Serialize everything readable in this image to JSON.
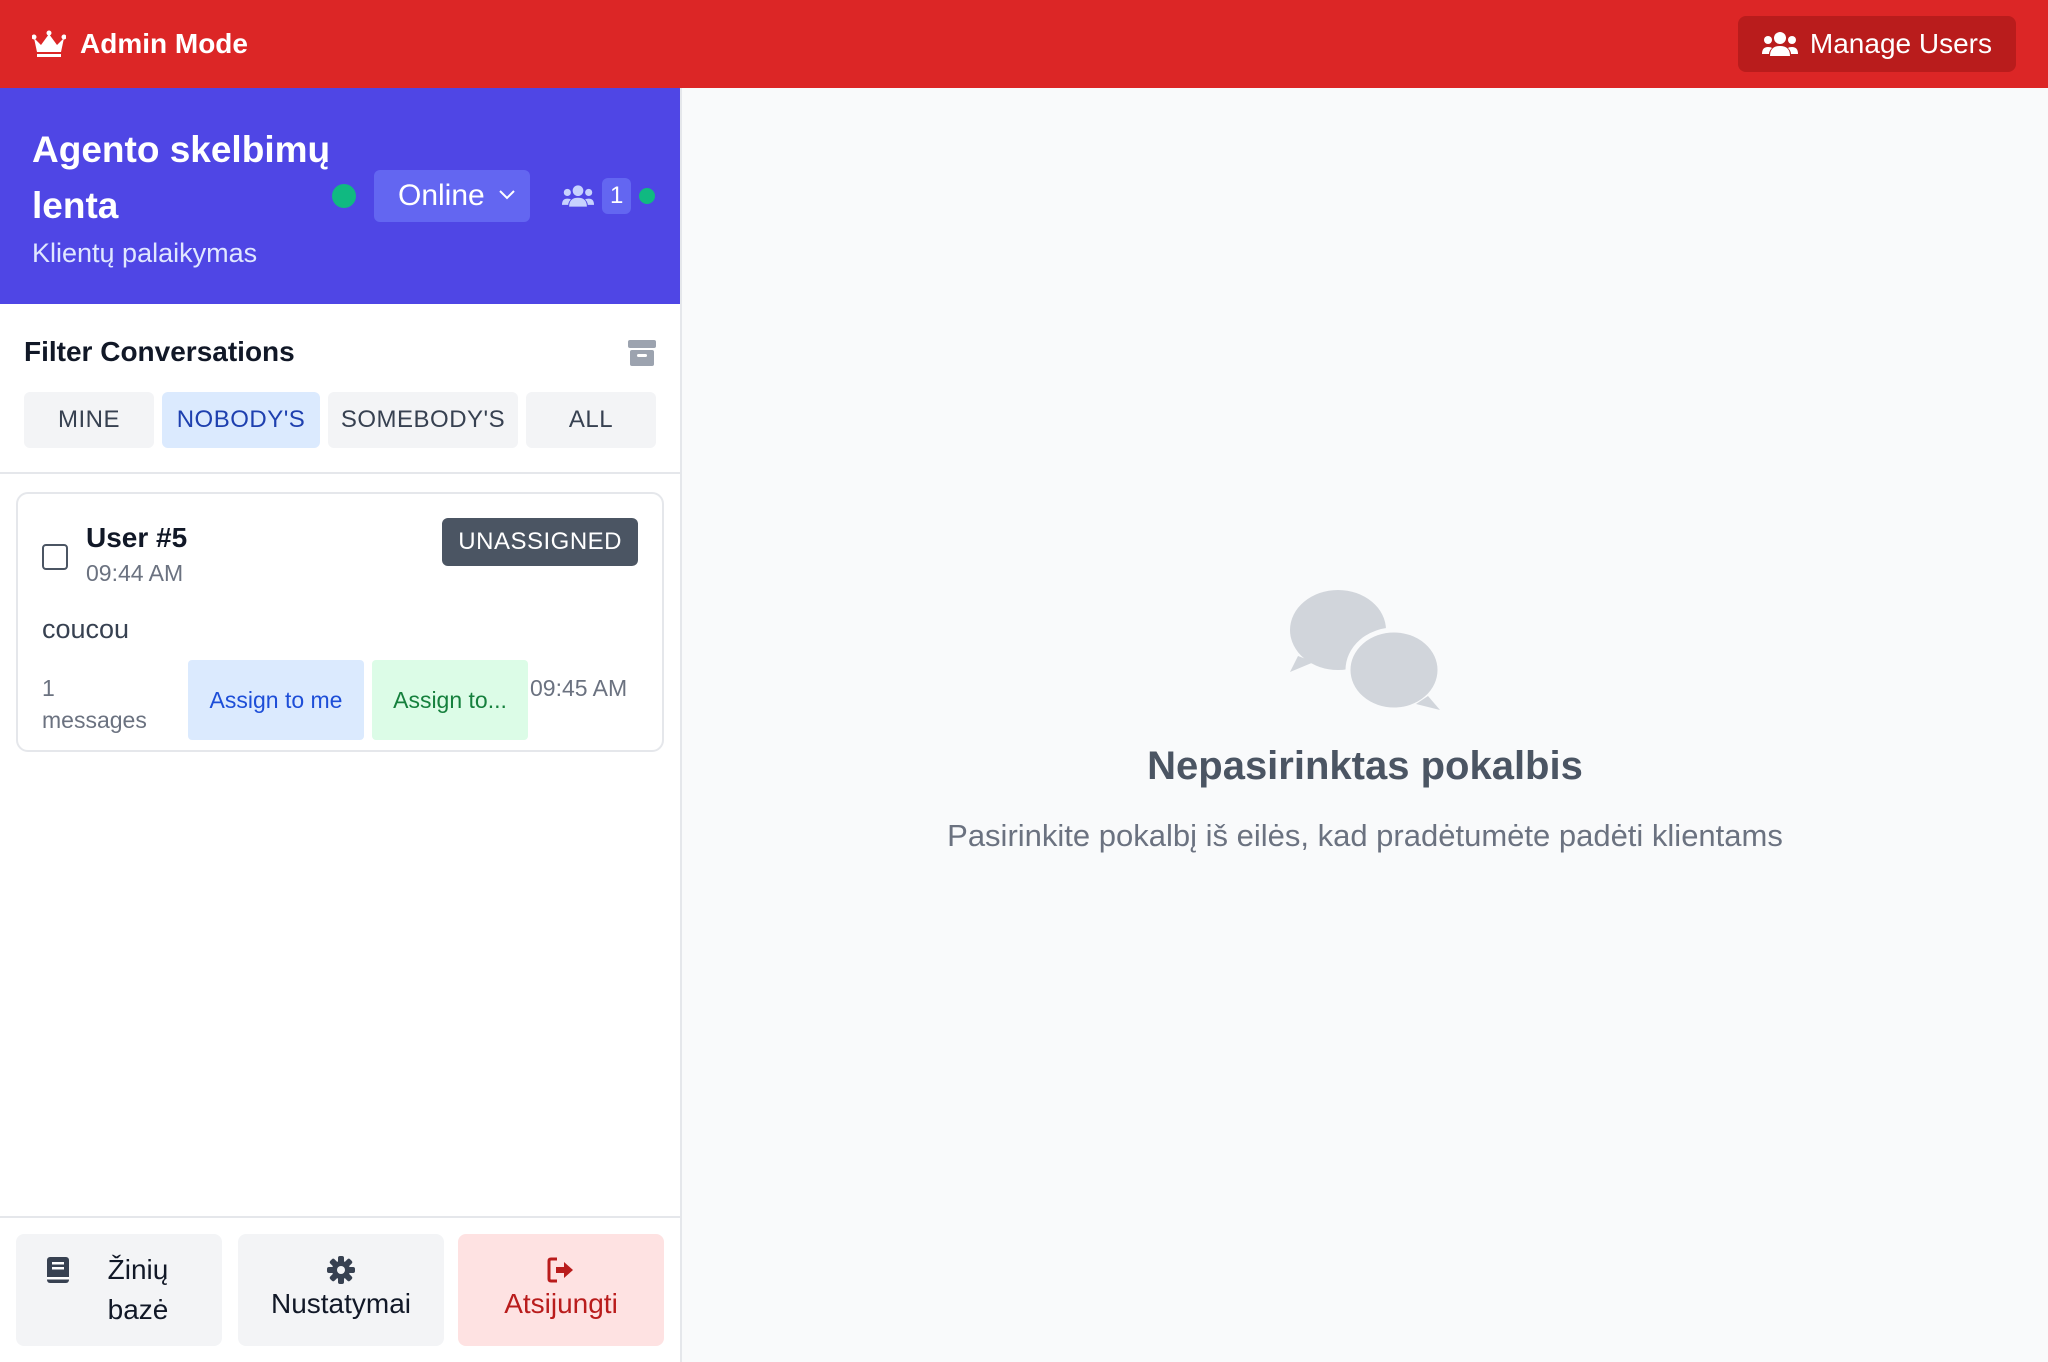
{
  "admin_bar": {
    "title": "Admin Mode",
    "manage_users_label": "Manage Users",
    "color": "#dc2626"
  },
  "agent": {
    "title": "Agento skelbimų lenta",
    "subtitle": "Klientų palaikymas",
    "status": "Online",
    "online_users": "1",
    "accent_color": "#4f46e5"
  },
  "filter": {
    "title": "Filter Conversations",
    "tabs": [
      {
        "label": "MINE",
        "active": false
      },
      {
        "label": "NOBODY'S",
        "active": true
      },
      {
        "label": "SOMEBODY'S",
        "active": false
      },
      {
        "label": "ALL",
        "active": false
      }
    ]
  },
  "conversations": [
    {
      "user": "User #5",
      "time": "09:44 AM",
      "badge": "UNASSIGNED",
      "message": "coucou",
      "message_count": "1 messages",
      "assign_me_label": "Assign to me",
      "assign_to_label": "Assign to...",
      "last_time": "09:45 AM"
    }
  ],
  "bottom": {
    "knowledge_base": "Žinių bazė",
    "settings": "Nustatymai",
    "logout": "Atsijungti"
  },
  "main": {
    "empty_title": "Nepasirinktas pokalbis",
    "empty_subtitle": "Pasirinkite pokalbį iš eilės, kad pradėtumėte padėti klientams"
  }
}
